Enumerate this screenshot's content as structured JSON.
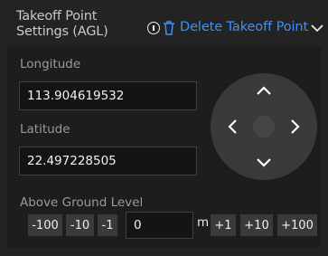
{
  "header": {
    "title": "Takeoff Point Settings (AGL)",
    "delete_label": "Delete Takeoff Point"
  },
  "longitude": {
    "label": "Longitude",
    "value": "113.904619532"
  },
  "latitude": {
    "label": "Latitude",
    "value": "22.497228505"
  },
  "agl": {
    "label": "Above Ground Level",
    "value": "0",
    "unit": "m",
    "decrements": [
      "-100",
      "-10",
      "-1"
    ],
    "increments": [
      "+1",
      "+10",
      "+100"
    ]
  },
  "colors": {
    "accent": "#3f8ff7",
    "panel": "#232323",
    "inner": "#1d1d1d"
  }
}
